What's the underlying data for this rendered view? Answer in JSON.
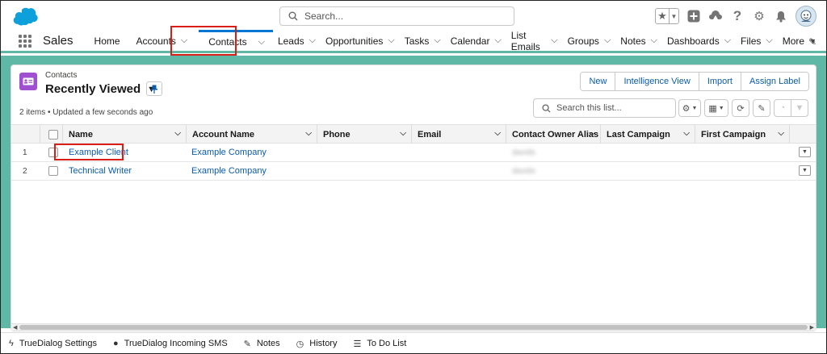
{
  "header": {
    "search_placeholder": "Search..."
  },
  "nav": {
    "app_name": "Sales",
    "items": [
      {
        "label": "Home",
        "has_menu": false
      },
      {
        "label": "Accounts",
        "has_menu": true
      },
      {
        "label": "Contacts",
        "has_menu": true,
        "active": true
      },
      {
        "label": "Leads",
        "has_menu": true
      },
      {
        "label": "Opportunities",
        "has_menu": true
      },
      {
        "label": "Tasks",
        "has_menu": true
      },
      {
        "label": "Calendar",
        "has_menu": true
      },
      {
        "label": "List Emails",
        "has_menu": true
      },
      {
        "label": "Groups",
        "has_menu": true
      },
      {
        "label": "Notes",
        "has_menu": true
      },
      {
        "label": "Dashboards",
        "has_menu": true
      },
      {
        "label": "Files",
        "has_menu": true
      },
      {
        "label": "More",
        "has_menu": true
      }
    ]
  },
  "list_view": {
    "object_label": "Contacts",
    "title": "Recently Viewed",
    "meta": "2 items • Updated a few seconds ago",
    "search_placeholder": "Search this list...",
    "buttons": [
      "New",
      "Intelligence View",
      "Import",
      "Assign Label"
    ],
    "columns": [
      "Name",
      "Account Name",
      "Phone",
      "Email",
      "Contact Owner Alias",
      "Last Campaign",
      "First Campaign"
    ],
    "rows": [
      {
        "num": "1",
        "name": "Example Client",
        "account": "Example Company",
        "phone": "",
        "email": "",
        "owner_alias": "davids",
        "last_campaign": "",
        "first_campaign": ""
      },
      {
        "num": "2",
        "name": "Technical Writer",
        "account": "Example Company",
        "phone": "",
        "email": "",
        "owner_alias": "davids",
        "last_campaign": "",
        "first_campaign": ""
      }
    ]
  },
  "utility_bar": {
    "items": [
      {
        "label": "TrueDialog Settings",
        "icon": "bolt-icon"
      },
      {
        "label": "TrueDialog Incoming SMS",
        "icon": "chat-icon"
      },
      {
        "label": "Notes",
        "icon": "note-icon"
      },
      {
        "label": "History",
        "icon": "clock-icon"
      },
      {
        "label": "To Do List",
        "icon": "checklist-icon"
      }
    ]
  },
  "colors": {
    "brand_blue": "#0176d3",
    "link": "#0b5cab",
    "teal_background": "#5fb7a6",
    "contact_icon": "#a04fd0",
    "highlight": "#d91e18"
  }
}
